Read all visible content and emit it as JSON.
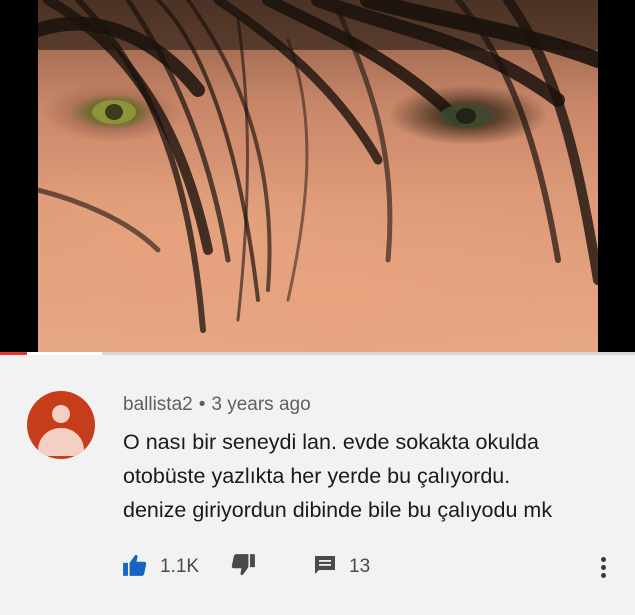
{
  "video": {
    "progress_played": 0.042,
    "buffered_to": 0.16
  },
  "comment": {
    "author": "ballista2",
    "separator": "•",
    "time": "3 years ago",
    "lines": [
      "O nası bir seneydi lan. evde sokakta okulda",
      "otobüste yazlıkta her yerde bu çalıyordu.",
      "denize giriyordun dibinde bile bu çalıyodu mk"
    ],
    "likes": "1.1K",
    "replies": "13"
  },
  "colors": {
    "like_active": "#1565c0",
    "avatar_bg": "#c63d1c",
    "progress": "#e53935"
  },
  "icons": {
    "like": "thumbs-up-icon",
    "dislike": "thumbs-down-icon",
    "reply": "comment-icon",
    "more": "more-vertical-icon"
  }
}
